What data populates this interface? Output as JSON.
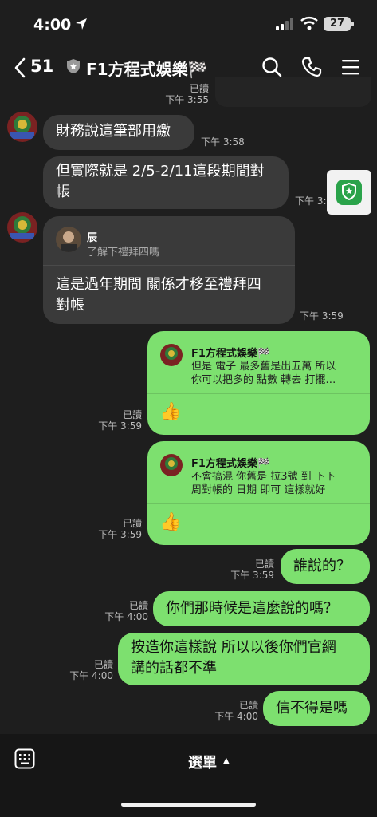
{
  "status": {
    "time": "4:00",
    "battery": "27"
  },
  "header": {
    "back_count": "51",
    "title": "F1方程式娛樂🏁"
  },
  "top_partial": {
    "read": "已讀",
    "time": "下午 3:55"
  },
  "messages": {
    "m1": {
      "text": "財務說這筆部用繳",
      "time": "下午 3:58"
    },
    "m2": {
      "line1": "但實際就是 2/5-2/11這段期間對",
      "line2": "帳",
      "time": "下午 3:5"
    },
    "m3": {
      "quote_name": "辰",
      "quote_text": "了解下禮拜四嗎",
      "line1": "這是過年期間 關係才移至禮拜四",
      "line2": "對帳",
      "time": "下午 3:59"
    },
    "m4": {
      "quote_name": "F1方程式娛樂🏁",
      "quote_line1": "但是 電子 最多舊是出五萬 所以",
      "quote_line2": "你可以把多的 點數 轉去 打擺…",
      "emoji": "👍",
      "read": "已讀",
      "time": "下午 3:59"
    },
    "m5": {
      "quote_name": "F1方程式娛樂🏁",
      "quote_line1": "不會搞混 你舊是 拉3號 到 下下",
      "quote_line2": "周對帳的 日期 即可 這樣就好",
      "emoji": "👍",
      "read": "已讀",
      "time": "下午 3:59"
    },
    "m6": {
      "text": "誰說的？",
      "read": "已讀",
      "time": "下午 3:59"
    },
    "m7": {
      "text": "你們那時候是這麼說的嗎？",
      "read": "已讀",
      "time": "下午 4:00"
    },
    "m8": {
      "line1": "按造你這樣說 所以以後你們官網",
      "line2": "講的話都不準",
      "read": "已讀",
      "time": "下午 4:00"
    },
    "m9": {
      "text": "信不得是嗎",
      "read": "已讀",
      "time": "下午 4:00"
    }
  },
  "bottom": {
    "menu_label": "選單",
    "caret": "▲"
  },
  "colors": {
    "outgoing": "#7de06f",
    "incoming": "#3a3a3a",
    "background": "#1e1e1e"
  }
}
